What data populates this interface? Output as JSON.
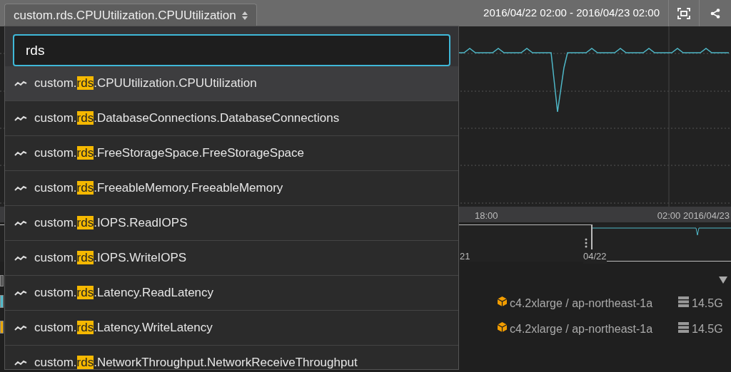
{
  "metric_selector": {
    "label": "custom.rds.CPUUtilization.CPUUtilization",
    "expanded": true
  },
  "time_range": "2016/04/22 02:00 - 2016/04/23 02:00",
  "chart": {
    "x_labels": [
      "18:00",
      "02:00 2016/04/23"
    ]
  },
  "navigator": {
    "labels": [
      "21",
      "04/22"
    ]
  },
  "instances": [
    {
      "color": "#4fb8c8",
      "type": "c4.2xlarge / ap-northeast-1a",
      "memory": "14.5G"
    },
    {
      "color": "#e8a500",
      "type": "c4.2xlarge / ap-northeast-1a",
      "memory": "14.5G"
    }
  ],
  "dropdown": {
    "search": "rds",
    "items": [
      {
        "prefix": "custom.",
        "match": "rds",
        "suffix": ".CPUUtilization.CPUUtilization",
        "selected": true
      },
      {
        "prefix": "custom.",
        "match": "rds",
        "suffix": ".DatabaseConnections.DatabaseConnections",
        "selected": false
      },
      {
        "prefix": "custom.",
        "match": "rds",
        "suffix": ".FreeStorageSpace.FreeStorageSpace",
        "selected": false
      },
      {
        "prefix": "custom.",
        "match": "rds",
        "suffix": ".FreeableMemory.FreeableMemory",
        "selected": false
      },
      {
        "prefix": "custom.",
        "match": "rds",
        "suffix": ".IOPS.ReadIOPS",
        "selected": false
      },
      {
        "prefix": "custom.",
        "match": "rds",
        "suffix": ".IOPS.WriteIOPS",
        "selected": false
      },
      {
        "prefix": "custom.",
        "match": "rds",
        "suffix": ".Latency.ReadLatency",
        "selected": false
      },
      {
        "prefix": "custom.",
        "match": "rds",
        "suffix": ".Latency.WriteLatency",
        "selected": false
      },
      {
        "prefix": "custom.",
        "match": "rds",
        "suffix": ".NetworkThroughput.NetworkReceiveThroughput",
        "selected": false
      }
    ]
  }
}
